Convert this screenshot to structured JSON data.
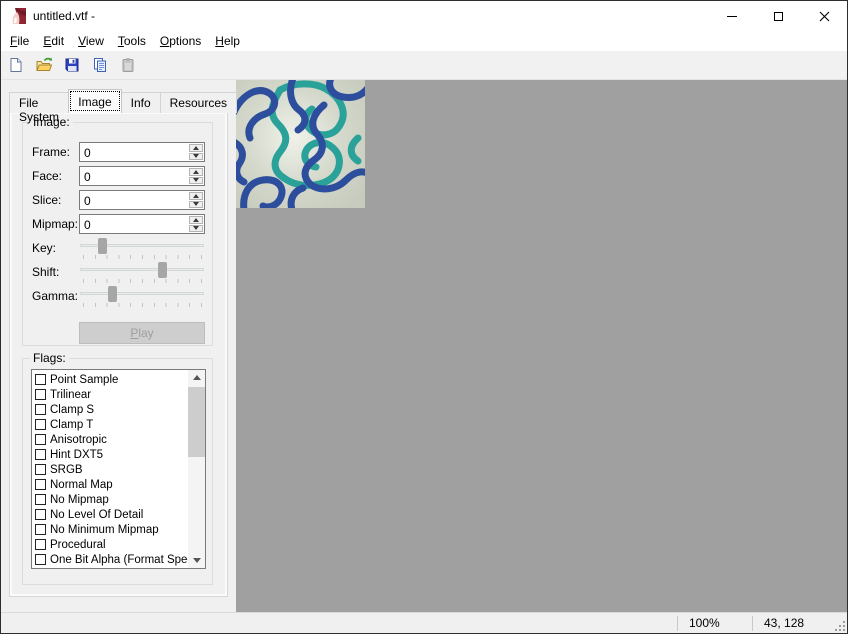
{
  "window": {
    "title": "untitled.vtf -",
    "controls": {
      "minimize": "minimize",
      "maximize": "maximize",
      "close": "close"
    }
  },
  "menu": {
    "items": [
      "File",
      "Edit",
      "View",
      "Tools",
      "Options",
      "Help"
    ]
  },
  "toolbar": {
    "buttons": [
      {
        "icon": "new-file-icon",
        "enabled": true
      },
      {
        "icon": "open-file-icon",
        "enabled": true
      },
      {
        "icon": "save-icon",
        "enabled": true
      },
      {
        "icon": "copy-icon",
        "enabled": true
      },
      {
        "icon": "paste-icon",
        "enabled": false
      }
    ]
  },
  "tabs": [
    {
      "label": "File System",
      "active": false
    },
    {
      "label": "Image",
      "active": true
    },
    {
      "label": "Info",
      "active": false
    },
    {
      "label": "Resources",
      "active": false
    }
  ],
  "image_panel": {
    "group_label": "Image:",
    "fields": [
      {
        "label": "Frame:",
        "value": "0"
      },
      {
        "label": "Face:",
        "value": "0"
      },
      {
        "label": "Slice:",
        "value": "0"
      },
      {
        "label": "Mipmap:",
        "value": "0"
      }
    ],
    "sliders": [
      {
        "label": "Key:",
        "percent": 19
      },
      {
        "label": "Shift:",
        "percent": 67
      },
      {
        "label": "Gamma:",
        "percent": 27
      }
    ],
    "play_label": "Play",
    "play_enabled": false
  },
  "flags_panel": {
    "group_label": "Flags:",
    "items": [
      {
        "label": "Point Sample",
        "checked": false
      },
      {
        "label": "Trilinear",
        "checked": false
      },
      {
        "label": "Clamp S",
        "checked": false
      },
      {
        "label": "Clamp T",
        "checked": false
      },
      {
        "label": "Anisotropic",
        "checked": false
      },
      {
        "label": "Hint DXT5",
        "checked": false
      },
      {
        "label": "SRGB",
        "checked": false
      },
      {
        "label": "Normal Map",
        "checked": false
      },
      {
        "label": "No Mipmap",
        "checked": false
      },
      {
        "label": "No Level Of Detail",
        "checked": false
      },
      {
        "label": "No Minimum Mipmap",
        "checked": false
      },
      {
        "label": "Procedural",
        "checked": false
      },
      {
        "label": "One Bit Alpha (Format Spec",
        "checked": false
      }
    ]
  },
  "status_bar": {
    "zoom": "100%",
    "coords": "43, 128"
  },
  "colors": {
    "canvas_bg": "#a0a0a0",
    "panel_bg": "#f0f0f0",
    "texture_blue": "#2d4e9c",
    "texture_teal": "#2aa29a",
    "texture_bg": "#c9cec1"
  }
}
